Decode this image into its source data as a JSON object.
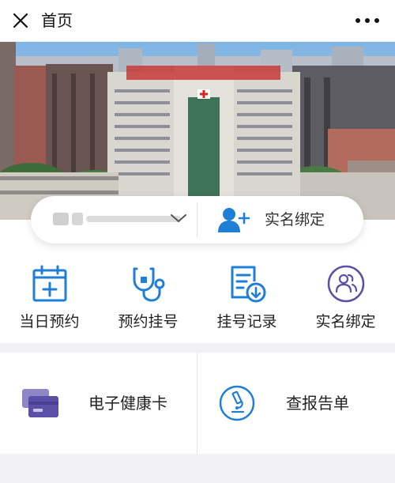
{
  "topbar": {
    "title": "首页",
    "close_icon": "close-icon",
    "more_icon": "more-icon"
  },
  "banner": {
    "type": "photo",
    "subject": "hospital-building"
  },
  "account_bar": {
    "selected_patient": "",
    "bind_label": "实名绑定",
    "chevron_icon": "chevron-down-icon",
    "bind_icon": "user-plus-icon"
  },
  "quick_actions": [
    {
      "label": "当日预约",
      "icon": "calendar-plus-icon"
    },
    {
      "label": "预约挂号",
      "icon": "stethoscope-icon"
    },
    {
      "label": "挂号记录",
      "icon": "record-download-icon"
    },
    {
      "label": "实名绑定",
      "icon": "user-group-icon"
    }
  ],
  "cards": [
    {
      "label": "电子健康卡",
      "icon": "health-card-icon"
    },
    {
      "label": "查报告单",
      "icon": "microscope-icon"
    }
  ],
  "colors": {
    "accent_blue": "#1f7ed6",
    "card_purple": "#5b4fa8",
    "background": "#f2f2f4"
  }
}
